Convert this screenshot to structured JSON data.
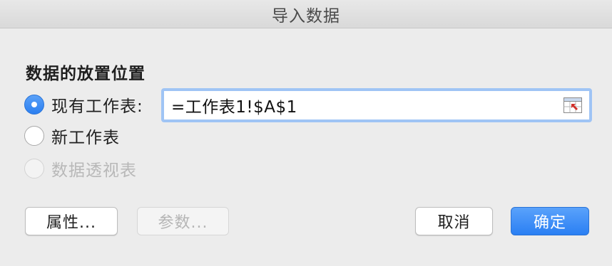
{
  "window": {
    "title": "导入数据"
  },
  "section": {
    "title": "数据的放置位置"
  },
  "options": {
    "existing_sheet": {
      "label": "现有工作表:",
      "checked": true
    },
    "new_sheet": {
      "label": "新工作表",
      "checked": false
    },
    "pivot_table": {
      "label": "数据透视表",
      "checked": false,
      "disabled": true
    }
  },
  "reference_field": {
    "value": "=工作表1!$A$1",
    "button_icon": "collapse-dialog-icon"
  },
  "buttons": {
    "properties": "属性...",
    "parameters": "参数...",
    "cancel": "取消",
    "ok": "确定"
  },
  "colors": {
    "accent": "#2b7ff0",
    "focus_ring": "#9fc4f5",
    "disabled_text": "#b8b8b8"
  }
}
